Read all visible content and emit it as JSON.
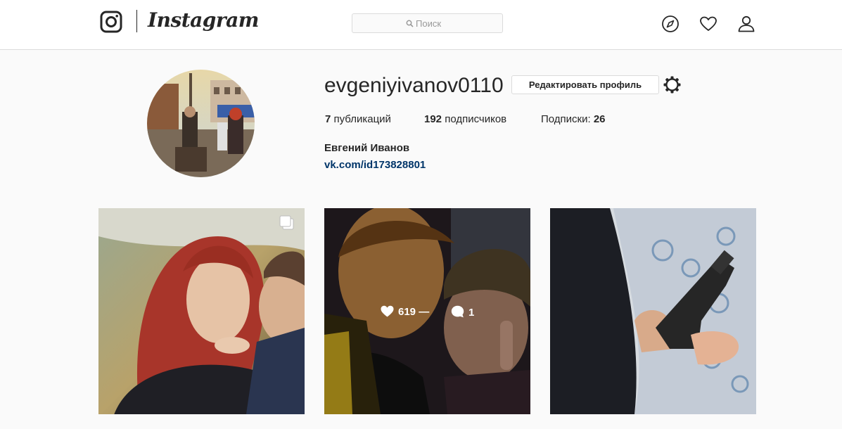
{
  "header": {
    "logo_text": "Instagram",
    "search_placeholder": "Поиск",
    "nav_icons": [
      "compass-icon",
      "heart-icon",
      "person-icon"
    ]
  },
  "profile": {
    "username": "evgeniyivanov0110",
    "edit_button_label": "Редактировать профиль",
    "stats": {
      "posts_count": "7",
      "posts_label": " публикаций",
      "followers_count": "192",
      "followers_label": " подписчиков",
      "following_label": "Подписки: ",
      "following_count": "26"
    },
    "full_name": "Евгений Иванов",
    "link": "vk.com/id173828801"
  },
  "posts": [
    {
      "type": "multi-image",
      "icon": "multiple-photos-icon"
    },
    {
      "hovered": true,
      "likes": "619 —",
      "comments": "1"
    },
    {
      "type": "image"
    }
  ],
  "colors": {
    "background": "#fafafa",
    "header_bg": "#ffffff",
    "border": "#dbdbdb",
    "text": "#262626",
    "link": "#003569"
  }
}
